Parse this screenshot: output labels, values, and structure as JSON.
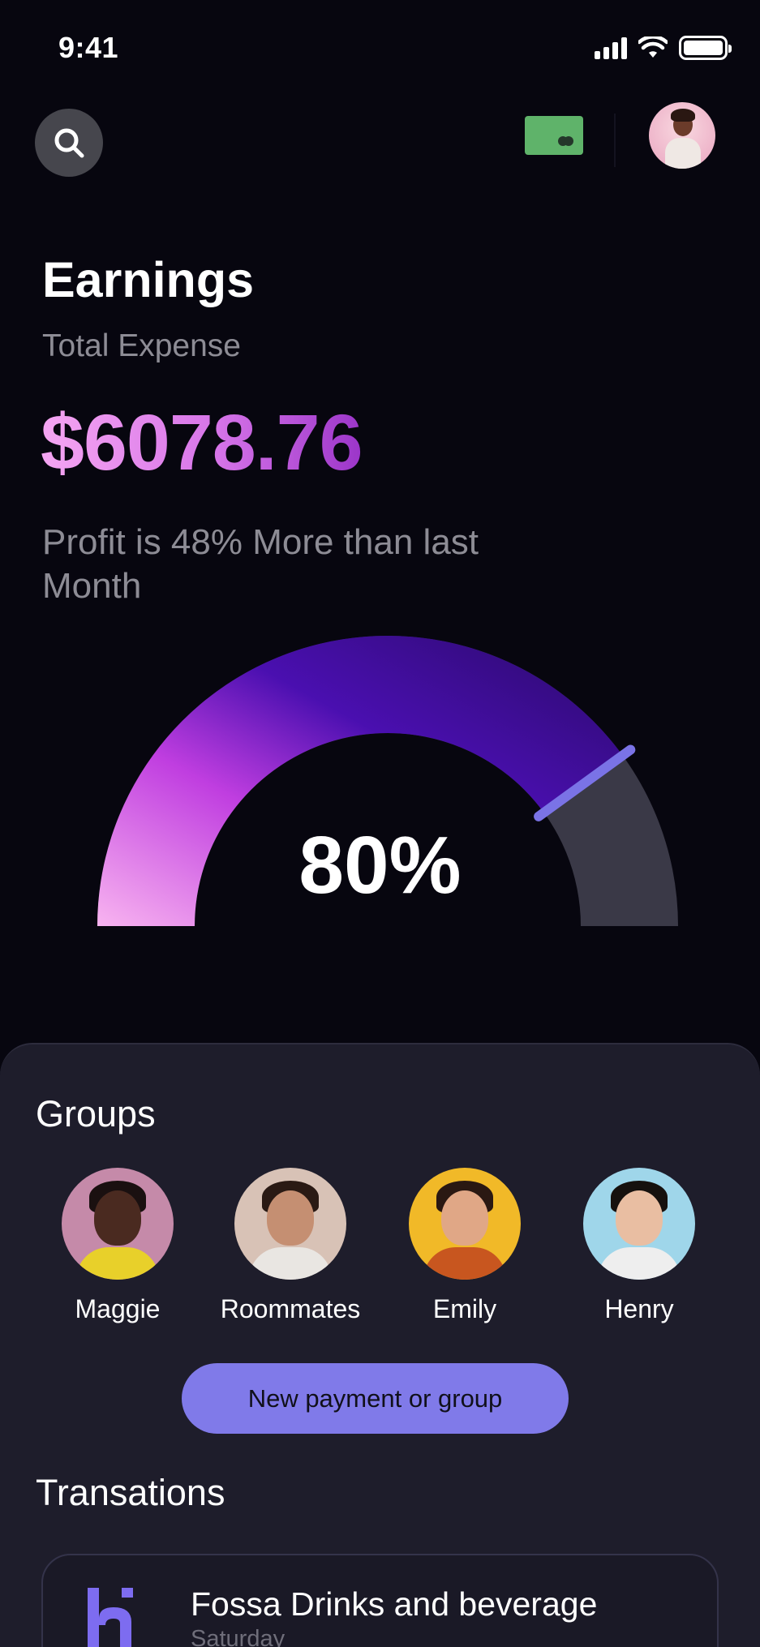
{
  "status_bar": {
    "time": "9:41"
  },
  "header": {
    "search_icon": "search-icon",
    "card_icon": "card-icon",
    "avatar_icon": "user-avatar"
  },
  "earnings": {
    "title": "Earnings",
    "subtitle": "Total Expense",
    "amount": "$6078.76",
    "profit_text": "Profit is 48% More than last Month",
    "gauge_label": "80%",
    "gauge_fraction": 0.8,
    "colors": {
      "gradient_start": "#f8b4f0",
      "gradient_mid": "#c03ee0",
      "gradient_end": "#2a0a6a",
      "needle": "#7a73e6",
      "track": "#3a3947"
    }
  },
  "groups": {
    "title": "Groups",
    "items": [
      {
        "name": "Maggie",
        "bg": "#c58aa9",
        "skin": "#4a2a20",
        "hair": "#1a1010",
        "shirt": "#e8d02a"
      },
      {
        "name": "Roommates",
        "bg": "#d8c2b6",
        "skin": "#c58f72",
        "hair": "#2a1a14",
        "shirt": "#e9e6e2"
      },
      {
        "name": "Emily",
        "bg": "#f1b928",
        "skin": "#e0a786",
        "hair": "#2a1812",
        "shirt": "#c8561f"
      },
      {
        "name": "Henry",
        "bg": "#9fd6ea",
        "skin": "#e9bea2",
        "hair": "#16110e",
        "shirt": "#eeeeee"
      }
    ],
    "new_button_label": "New payment or group",
    "accent": "#807ae9"
  },
  "transactions": {
    "title": "Transations",
    "items": [
      {
        "name": "Fossa Drinks and beverage",
        "date": "Saturday"
      }
    ]
  }
}
